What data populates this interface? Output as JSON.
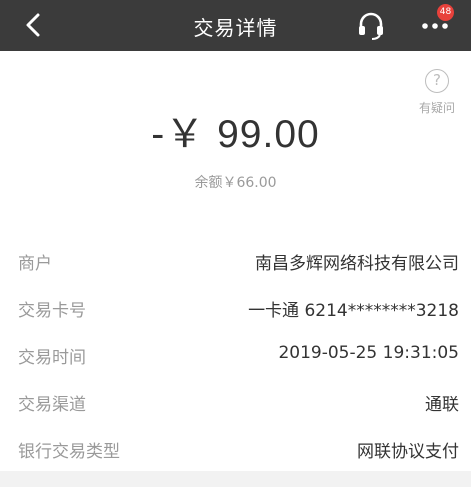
{
  "header": {
    "title": "交易详情",
    "badge_count": "48",
    "icons": {
      "back": "back-arrow-icon",
      "service": "headset-icon",
      "more": "more-dots-icon"
    }
  },
  "help": {
    "icon": "question-icon",
    "glyph": "?",
    "label": "有疑问"
  },
  "amount": "-￥ 99.00",
  "balance": "余额￥66.00",
  "details": [
    {
      "label": "商户",
      "value": "南昌多辉网络科技有限公司"
    },
    {
      "label": "交易卡号",
      "value": "一卡通 6214********3218"
    },
    {
      "label": "交易时间",
      "value": "2019-05-25 19:31:05"
    },
    {
      "label": "交易渠道",
      "value": "通联"
    },
    {
      "label": "银行交易类型",
      "value": "网联协议支付"
    }
  ],
  "colors": {
    "topbar": "#3b3b3b",
    "badge": "#e8413b",
    "label": "#9a9a9a",
    "text": "#333333"
  }
}
